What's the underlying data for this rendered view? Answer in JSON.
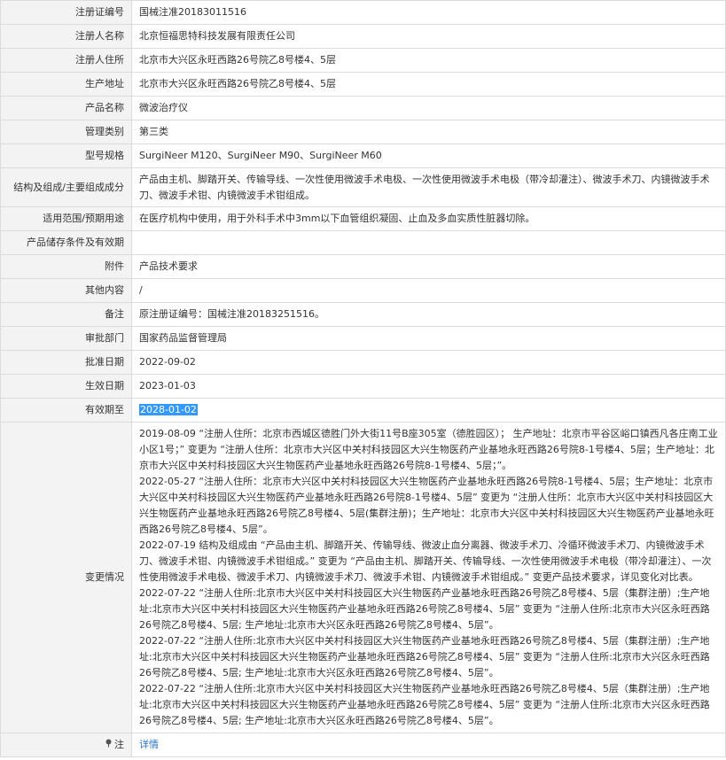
{
  "rows": [
    {
      "label": "注册证编号",
      "value": "国械注准20183011516"
    },
    {
      "label": "注册人名称",
      "value": "北京恒福思特科技发展有限责任公司"
    },
    {
      "label": "注册人住所",
      "value": "北京市大兴区永旺西路26号院乙8号楼4、5层"
    },
    {
      "label": "生产地址",
      "value": "北京市大兴区永旺西路26号院乙8号楼4、5层"
    },
    {
      "label": "产品名称",
      "value": "微波治疗仪"
    },
    {
      "label": "管理类别",
      "value": "第三类"
    },
    {
      "label": "型号规格",
      "value": "SurgiNeer M120、SurgiNeer M90、SurgiNeer M60"
    },
    {
      "label": "结构及组成/主要组成成分",
      "value": "产品由主机、脚踏开关、传输导线、一次性使用微波手术电极、一次性使用微波手术电极（带冷却灌注）、微波手术刀、内镜微波手术刀、微波手术钳、内镜微波手术钳组成。"
    },
    {
      "label": "适用范围/预期用途",
      "value": "在医疗机构中使用，用于外科手术中3mm以下血管组织凝固、止血及多血实质性脏器切除。"
    },
    {
      "label": "产品储存条件及有效期",
      "value": ""
    },
    {
      "label": "附件",
      "value": "产品技术要求"
    },
    {
      "label": "其他内容",
      "value": "/"
    },
    {
      "label": "备注",
      "value": "原注册证编号：国械注准20183251516。"
    },
    {
      "label": "审批部门",
      "value": "国家药品监督管理局"
    },
    {
      "label": "批准日期",
      "value": "2022-09-02"
    },
    {
      "label": "生效日期",
      "value": "2023-01-03"
    },
    {
      "label": "有效期至",
      "value": "2028-01-02"
    }
  ],
  "changes": {
    "label": "变更情况",
    "entries": [
      "2019-08-09 “注册人住所：北京市西城区德胜门外大街11号B座305室（德胜园区）； 生产地址：北京市平谷区峪口镇西凡各庄南工业小区1号；” 变更为 “注册人住所：北京市大兴区中关村科技园区大兴生物医药产业基地永旺西路26号院8-1号楼4、5层；生产地址：北京市大兴区中关村科技园区大兴生物医药产业基地永旺西路26号院8-1号楼4、5层；”。",
      "2022-05-27 “注册人住所：北京市大兴区中关村科技园区大兴生物医药产业基地永旺西路26号院8-1号楼4、5层；生产地址：北京市大兴区中关村科技园区大兴生物医药产业基地永旺西路26号院8-1号楼4、5层” 变更为 “注册人住所：北京市大兴区中关村科技园区大兴生物医药产业基地永旺西路26号院乙8号楼4、5层(集群注册)；生产地址：北京市大兴区中关村科技园区大兴生物医药产业基地永旺西路26号院乙8号楼4、5层”。",
      "2022-07-19 结构及组成由 “产品由主机、脚踏开关、传输导线、微波止血分离器、微波手术刀、冷循环微波手术刀、内镜微波手术刀、微波手术钳、内镜微波手术钳组成。” 变更为 “产品由主机、脚踏开关、传输导线、一次性使用微波手术电极（带冷却灌注）、一次性使用微波手术电极、微波手术刀、内镜微波手术刀、微波手术钳、内镜微波手术钳组成。” 变更产品技术要求，详见变化对比表。",
      "2022-07-22 “注册人住所:北京市大兴区中关村科技园区大兴生物医药产业基地永旺西路26号院乙8号楼4、5层（集群注册）;生产地址:北京市大兴区中关村科技园区大兴生物医药产业基地永旺西路26号院乙8号楼4、5层” 变更为 “注册人住所:北京市大兴区永旺西路26号院乙8号楼4、5层; 生产地址:北京市大兴区永旺西路26号院乙8号楼4、5层”。",
      "2022-07-22 “注册人住所:北京市大兴区中关村科技园区大兴生物医药产业基地永旺西路26号院乙8号楼4、5层（集群注册）;生产地址:北京市大兴区中关村科技园区大兴生物医药产业基地永旺西路26号院乙8号楼4、5层” 变更为 “注册人住所:北京市大兴区永旺西路26号院乙8号楼4、5层; 生产地址:北京市大兴区永旺西路26号院乙8号楼4、5层”。",
      "2022-07-22 “注册人住所:北京市大兴区中关村科技园区大兴生物医药产业基地永旺西路26号院乙8号楼4、5层（集群注册）;生产地址:北京市大兴区中关村科技园区大兴生物医药产业基地永旺西路26号院乙8号楼4、5层” 变更为 “注册人住所:北京市大兴区永旺西路26号院乙8号楼4、5层; 生产地址:北京市大兴区永旺西路26号院乙8号楼4、5层”。"
    ]
  },
  "note": {
    "label": "注",
    "icon": "pin-icon",
    "link_text": "详情"
  }
}
